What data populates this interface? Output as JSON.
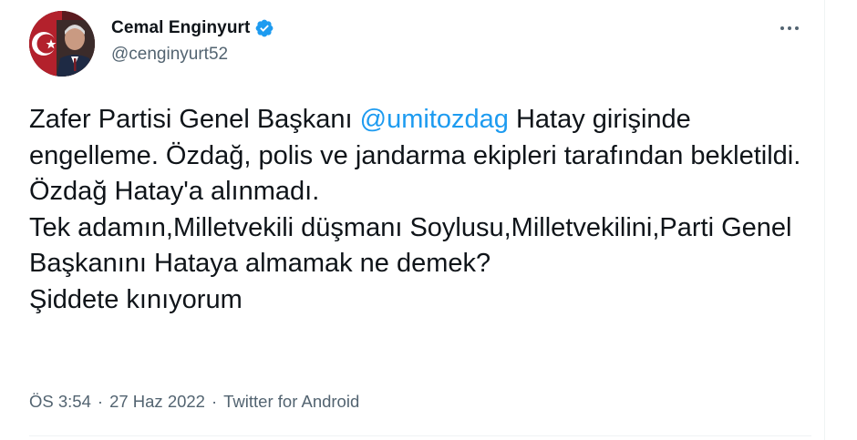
{
  "author": {
    "display_name": "Cemal Enginyurt",
    "handle": "@cenginyurt52",
    "verified": true
  },
  "tweet": {
    "text_before": "Zafer Partisi Genel Başkanı ",
    "mention": "@umitozdag",
    "text_after": " Hatay girişinde engelleme. Özdağ, polis ve jandarma ekipleri tarafından bekletildi. Özdağ Hatay'a alınmadı.\nTek adamın,Milletvekili düşmanı Soylusu,Milletvekilini,Parti Genel Başkanını Hataya almamak ne demek?\nŞiddete kınıyorum"
  },
  "meta": {
    "time": "ÖS 3:54",
    "separator": "·",
    "date": "27 Haz 2022",
    "source": "Twitter for Android"
  },
  "icons": {
    "verified": "verified-badge-icon",
    "more": "more-horizontal-icon"
  },
  "colors": {
    "accent": "#1d9bf0",
    "text_primary": "#0f1419",
    "text_secondary": "#536471",
    "divider": "#eff3f4"
  }
}
